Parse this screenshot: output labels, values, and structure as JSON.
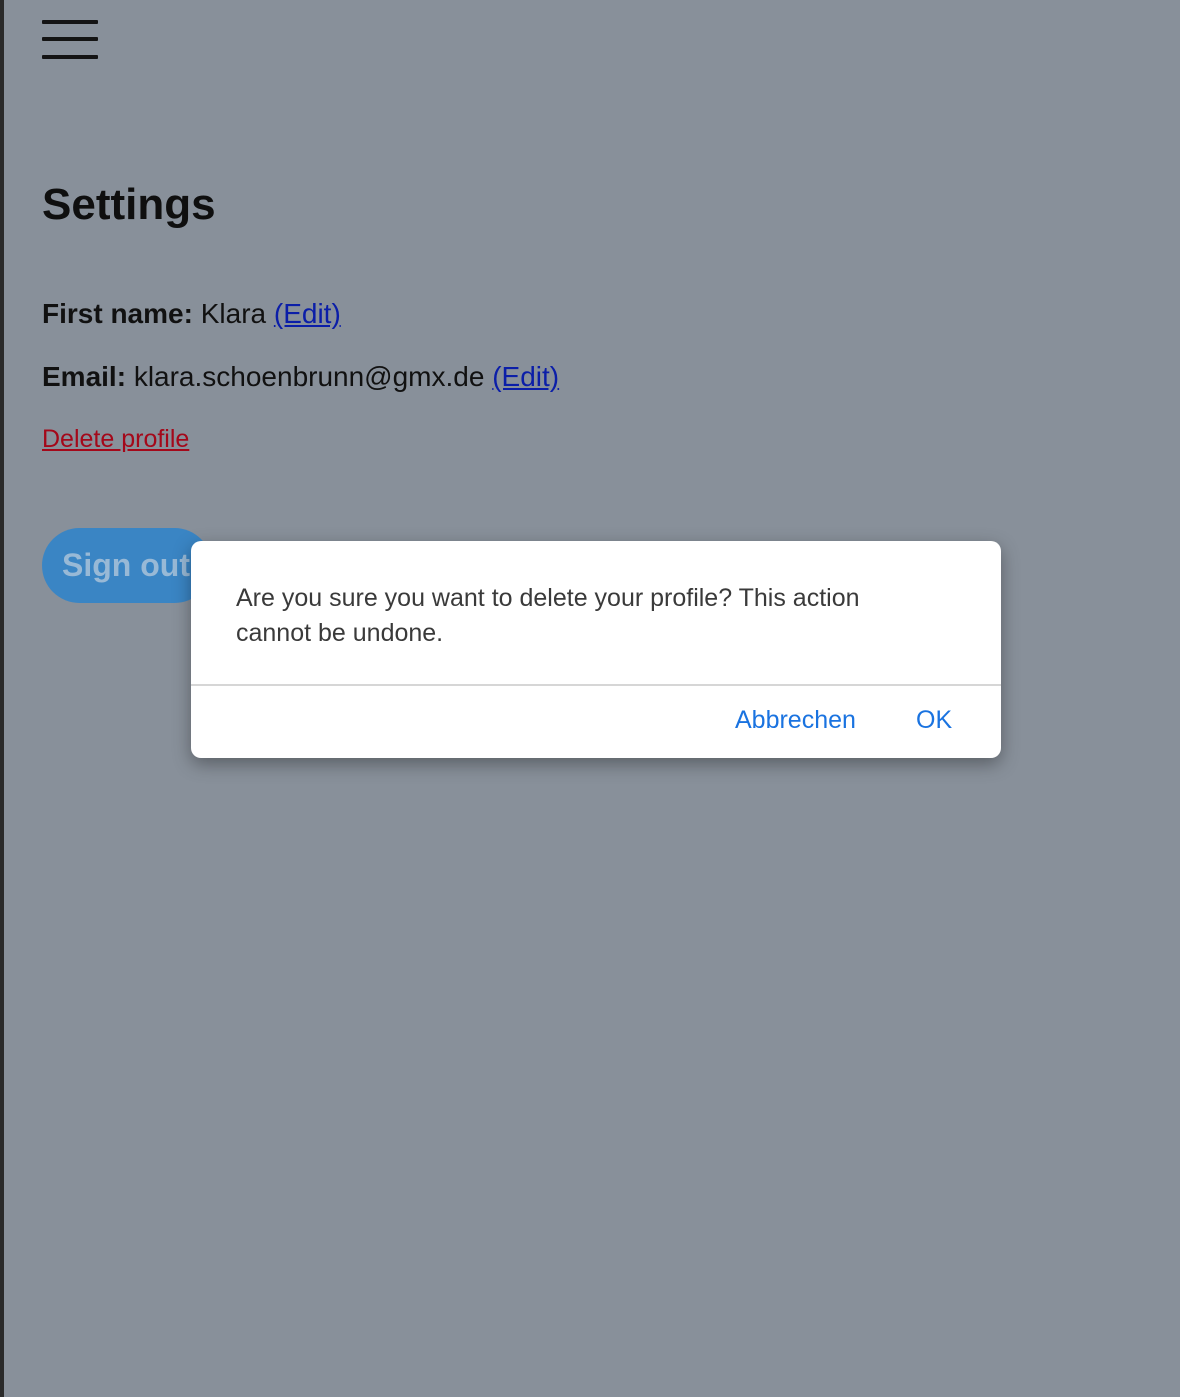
{
  "menu": {
    "icon": "hamburger-menu-icon"
  },
  "settings": {
    "title": "Settings",
    "first_name_label": "First name:",
    "first_name_value": "Klara",
    "email_label": "Email:",
    "email_value": "klara.schoenbrunn@gmx.de",
    "edit_label": "(Edit)",
    "delete_profile_label": "Delete profile",
    "sign_out_label": "Sign out"
  },
  "dialog": {
    "message": "Are you sure you want to delete your profile? This action cannot be undone.",
    "cancel_label": "Abbrechen",
    "ok_label": "OK"
  },
  "colors": {
    "overlay_background": "#88909a",
    "link_blue": "#0b1ea8",
    "delete_red": "#a4081a",
    "button_blue": "#3a85c4",
    "dialog_action_blue": "#1a73e0"
  }
}
